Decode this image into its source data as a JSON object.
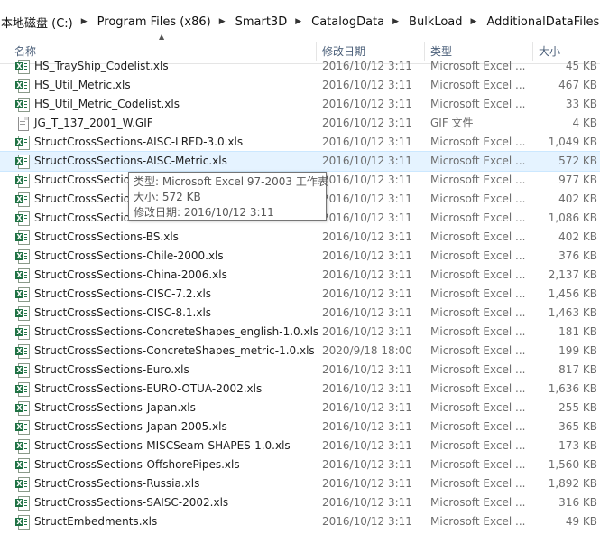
{
  "breadcrumb": [
    "本地磁盘 (C:)",
    "Program Files (x86)",
    "Smart3D",
    "CatalogData",
    "BulkLoad",
    "AdditionalDataFiles"
  ],
  "columns": {
    "name": "名称",
    "date": "修改日期",
    "type": "类型",
    "size": "大小"
  },
  "files": [
    {
      "name": "HS_TrayShip_Codelist.xls",
      "date": "2016/10/12 3:11",
      "type": "Microsoft Excel ...",
      "size": "45 KB",
      "icon": "excel-file-icon"
    },
    {
      "name": "HS_Util_Metric.xls",
      "date": "2016/10/12 3:11",
      "type": "Microsoft Excel ...",
      "size": "467 KB",
      "icon": "excel-file-icon"
    },
    {
      "name": "HS_Util_Metric_Codelist.xls",
      "date": "2016/10/12 3:11",
      "type": "Microsoft Excel ...",
      "size": "33 KB",
      "icon": "excel-file-icon"
    },
    {
      "name": "JG_T_137_2001_W.GIF",
      "date": "2016/10/12 3:11",
      "type": "GIF 文件",
      "size": "4 KB",
      "icon": "gif-file-icon"
    },
    {
      "name": "StructCrossSections-AISC-LRFD-3.0.xls",
      "date": "2016/10/12 3:11",
      "type": "Microsoft Excel ...",
      "size": "1,049 KB",
      "icon": "excel-file-icon"
    },
    {
      "name": "StructCrossSections-AISC-Metric.xls",
      "date": "2016/10/12 3:11",
      "type": "Microsoft Excel ...",
      "size": "572 KB",
      "icon": "excel-file-icon",
      "selected": true
    },
    {
      "name": "StructCrossSections-AISC-Metric.xls",
      "date": "2016/10/12 3:11",
      "type": "Microsoft Excel ...",
      "size": "977 KB",
      "icon": "excel-file-icon"
    },
    {
      "name": "StructCrossSections-AISC-Metric.xls",
      "date": "2016/10/12 3:11",
      "type": "Microsoft Excel ...",
      "size": "402 KB",
      "icon": "excel-file-icon"
    },
    {
      "name": "StructCrossSections-AISC-Metric.xls",
      "date": "2016/10/12 3:11",
      "type": "Microsoft Excel ...",
      "size": "1,086 KB",
      "icon": "excel-file-icon"
    },
    {
      "name": "StructCrossSections-BS.xls",
      "date": "2016/10/12 3:11",
      "type": "Microsoft Excel ...",
      "size": "402 KB",
      "icon": "excel-file-icon"
    },
    {
      "name": "StructCrossSections-Chile-2000.xls",
      "date": "2016/10/12 3:11",
      "type": "Microsoft Excel ...",
      "size": "376 KB",
      "icon": "excel-file-icon"
    },
    {
      "name": "StructCrossSections-China-2006.xls",
      "date": "2016/10/12 3:11",
      "type": "Microsoft Excel ...",
      "size": "2,137 KB",
      "icon": "excel-file-icon"
    },
    {
      "name": "StructCrossSections-CISC-7.2.xls",
      "date": "2016/10/12 3:11",
      "type": "Microsoft Excel ...",
      "size": "1,456 KB",
      "icon": "excel-file-icon"
    },
    {
      "name": "StructCrossSections-CISC-8.1.xls",
      "date": "2016/10/12 3:11",
      "type": "Microsoft Excel ...",
      "size": "1,463 KB",
      "icon": "excel-file-icon"
    },
    {
      "name": "StructCrossSections-ConcreteShapes_english-1.0.xls",
      "date": "2016/10/12 3:11",
      "type": "Microsoft Excel ...",
      "size": "181 KB",
      "icon": "excel-file-icon"
    },
    {
      "name": "StructCrossSections-ConcreteShapes_metric-1.0.xls",
      "date": "2020/9/18 18:00",
      "type": "Microsoft Excel ...",
      "size": "199 KB",
      "icon": "excel-file-icon"
    },
    {
      "name": "StructCrossSections-Euro.xls",
      "date": "2016/10/12 3:11",
      "type": "Microsoft Excel ...",
      "size": "817 KB",
      "icon": "excel-file-icon"
    },
    {
      "name": "StructCrossSections-EURO-OTUA-2002.xls",
      "date": "2016/10/12 3:11",
      "type": "Microsoft Excel ...",
      "size": "1,636 KB",
      "icon": "excel-file-icon"
    },
    {
      "name": "StructCrossSections-Japan.xls",
      "date": "2016/10/12 3:11",
      "type": "Microsoft Excel ...",
      "size": "255 KB",
      "icon": "excel-file-icon"
    },
    {
      "name": "StructCrossSections-Japan-2005.xls",
      "date": "2016/10/12 3:11",
      "type": "Microsoft Excel ...",
      "size": "365 KB",
      "icon": "excel-file-icon"
    },
    {
      "name": "StructCrossSections-MISCSeam-SHAPES-1.0.xls",
      "date": "2016/10/12 3:11",
      "type": "Microsoft Excel ...",
      "size": "173 KB",
      "icon": "excel-file-icon"
    },
    {
      "name": "StructCrossSections-OffshorePipes.xls",
      "date": "2016/10/12 3:11",
      "type": "Microsoft Excel ...",
      "size": "1,560 KB",
      "icon": "excel-file-icon"
    },
    {
      "name": "StructCrossSections-Russia.xls",
      "date": "2016/10/12 3:11",
      "type": "Microsoft Excel ...",
      "size": "1,892 KB",
      "icon": "excel-file-icon"
    },
    {
      "name": "StructCrossSections-SAISC-2002.xls",
      "date": "2016/10/12 3:11",
      "type": "Microsoft Excel ...",
      "size": "316 KB",
      "icon": "excel-file-icon"
    },
    {
      "name": "StructEmbedments.xls",
      "date": "2016/10/12 3:11",
      "type": "Microsoft Excel ...",
      "size": "49 KB",
      "icon": "excel-file-icon"
    }
  ],
  "tooltip": {
    "type_line": "类型: Microsoft Excel 97-2003 工作表",
    "size_line": "大小: 572 KB",
    "date_line": "修改日期: 2016/10/12 3:11"
  },
  "colors": {
    "selected_row": "#e5f3ff",
    "header_text": "#4c607a",
    "excel_green": "#1f7244"
  }
}
